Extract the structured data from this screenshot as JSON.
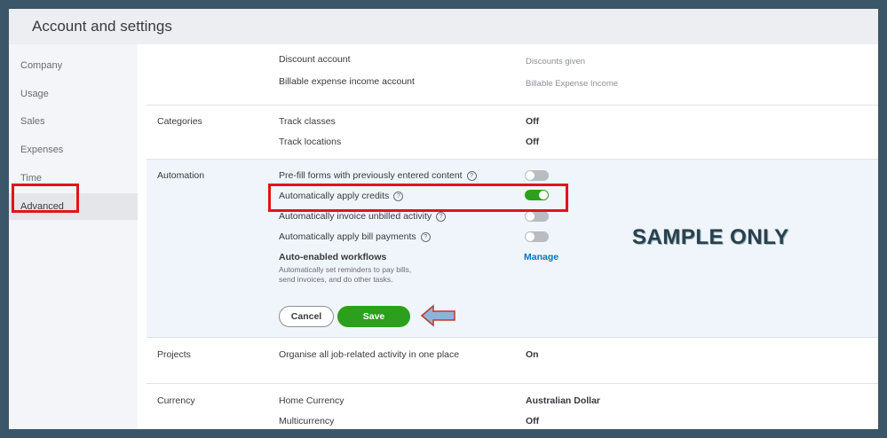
{
  "header": {
    "title": "Account and settings"
  },
  "sidebar": {
    "items": [
      {
        "label": "Company"
      },
      {
        "label": "Usage"
      },
      {
        "label": "Sales"
      },
      {
        "label": "Expenses"
      },
      {
        "label": "Time"
      },
      {
        "label": "Advanced"
      }
    ],
    "active": "Advanced"
  },
  "top_rows": {
    "discount_account": {
      "label": "Discount account",
      "value": "Discounts given"
    },
    "billable_expense": {
      "label": "Billable expense income account",
      "value": "Billable Expense Income"
    }
  },
  "categories": {
    "title": "Categories",
    "track_classes": {
      "label": "Track classes",
      "value": "Off"
    },
    "track_locations": {
      "label": "Track locations",
      "value": "Off"
    }
  },
  "automation": {
    "title": "Automation",
    "help_glyph": "?",
    "prefill": {
      "label": "Pre-fill forms with previously entered content",
      "state": "off"
    },
    "apply_credits": {
      "label": "Automatically apply credits",
      "state": "on"
    },
    "invoice_unbilled": {
      "label": "Automatically invoice unbilled activity",
      "state": "off"
    },
    "apply_bill_payments": {
      "label": "Automatically apply bill payments",
      "state": "off"
    },
    "workflows": {
      "label": "Auto-enabled workflows",
      "description_line1": "Automatically set reminders to pay bills,",
      "description_line2": "send invoices, and do other tasks.",
      "manage_label": "Manage"
    },
    "cancel_label": "Cancel",
    "save_label": "Save"
  },
  "projects": {
    "title": "Projects",
    "label": "Organise all job-related activity in one place",
    "value": "On"
  },
  "currency": {
    "title": "Currency",
    "home_currency": {
      "label": "Home Currency",
      "value": "Australian Dollar"
    },
    "multicurrency": {
      "label": "Multicurrency",
      "value": "Off"
    }
  },
  "watermark": "SAMPLE ONLY",
  "colors": {
    "accent_green": "#2ca01c",
    "highlight_red": "#e3131b",
    "link_blue": "#0077c5",
    "frame_border": "#3b5668"
  }
}
